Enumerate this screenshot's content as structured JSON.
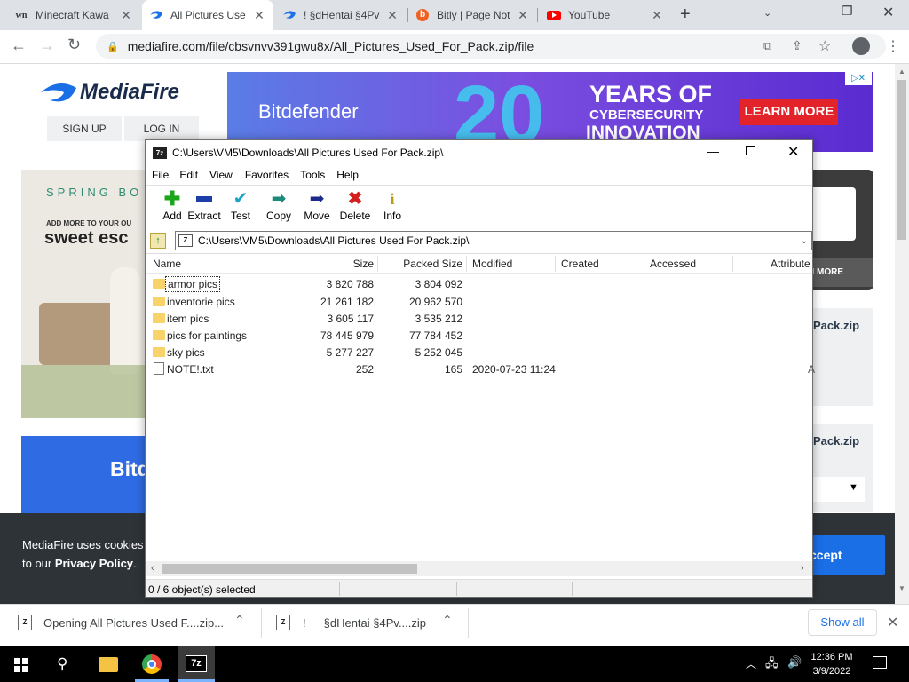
{
  "browser": {
    "tabs": [
      {
        "favicon": "wn",
        "title": "Minecraft Kawa",
        "active": false
      },
      {
        "favicon": "mediafire",
        "title": "All Pictures Use",
        "active": true
      },
      {
        "favicon": "mediafire",
        "title": "! §dHentai §4Pv",
        "active": false
      },
      {
        "favicon": "bitly",
        "title": "Bitly | Page Not",
        "active": false
      },
      {
        "favicon": "youtube",
        "title": "YouTube",
        "active": false
      }
    ],
    "url": "mediafire.com/file/cbsvnvv391gwu8x/All_Pictures_Used_For_Pack.zip/file"
  },
  "mediafire": {
    "logo": "MediaFire",
    "signup": "SIGN UP",
    "login": "LOG IN",
    "ad_banner": {
      "brand": "Bitdefender",
      "num": "20",
      "line1": "YEARS OF",
      "line2": "CYBERSECURITY",
      "line3": "INNOVATION",
      "cta": "LEARN MORE"
    },
    "side_ad": {
      "spring": "SPRING BO",
      "add_more": "ADD MORE TO YOUR OU",
      "sweet": "sweet esc"
    },
    "ad2_text": "Bitd",
    "learn_more_small": "N MORE",
    "file_label_1": "Pack.zip",
    "file_label_2": "Pack.zip",
    "cookie_line1": "MediaFire uses cookies",
    "cookie_line2a": "to our ",
    "cookie_link": "Privacy Policy",
    "cookie_line2b": "..",
    "accept": "ccept"
  },
  "zip": {
    "title": "C:\\Users\\VM5\\Downloads\\All Pictures Used For Pack.zip\\",
    "menu": [
      "File",
      "Edit",
      "View",
      "Favorites",
      "Tools",
      "Help"
    ],
    "toolbar": [
      {
        "id": "add",
        "label": "Add",
        "icon": "plus-icon",
        "color": "#1aa51a"
      },
      {
        "id": "extract",
        "label": "Extract",
        "icon": "minus-icon",
        "color": "#1b3fa8"
      },
      {
        "id": "test",
        "label": "Test",
        "icon": "check-icon",
        "color": "#19a3c7"
      },
      {
        "id": "copy",
        "label": "Copy",
        "icon": "copy-arrow-icon",
        "color": "#1a8a7a"
      },
      {
        "id": "move",
        "label": "Move",
        "icon": "move-arrow-icon",
        "color": "#1b2a8a"
      },
      {
        "id": "delete",
        "label": "Delete",
        "icon": "delete-x-icon",
        "color": "#d41f1f"
      },
      {
        "id": "info",
        "label": "Info",
        "icon": "info-icon",
        "color": "#b89a10"
      }
    ],
    "path": "C:\\Users\\VM5\\Downloads\\All Pictures Used For Pack.zip\\",
    "columns": {
      "name": "Name",
      "size": "Size",
      "packed": "Packed Size",
      "modified": "Modified",
      "created": "Created",
      "accessed": "Accessed",
      "attributes": "Attribute"
    },
    "files": [
      {
        "name": "armor pics",
        "type": "folder",
        "size": "3 820 788",
        "packed": "3 804 092",
        "modified": ""
      },
      {
        "name": "inventorie pics",
        "type": "folder",
        "size": "21 261 182",
        "packed": "20 962 570",
        "modified": ""
      },
      {
        "name": "item pics",
        "type": "folder",
        "size": "3 605 117",
        "packed": "3 535 212",
        "modified": ""
      },
      {
        "name": "pics for paintings",
        "type": "folder",
        "size": "78 445 979",
        "packed": "77 784 452",
        "modified": ""
      },
      {
        "name": "sky pics",
        "type": "folder",
        "size": "5 277 227",
        "packed": "5 252 045",
        "modified": ""
      },
      {
        "name": "NOTE!.txt",
        "type": "file",
        "size": "252",
        "packed": "165",
        "modified": "2020-07-23 11:24"
      }
    ],
    "attr_extra": "A",
    "status": "0 / 6 object(s) selected"
  },
  "downloads": {
    "item1": "Opening All Pictures Used F....zip...",
    "item2_prefix": "!",
    "item2": "§dHentai §4Pv....zip",
    "show_all": "Show all"
  },
  "taskbar": {
    "time": "12:36 PM",
    "date": "3/9/2022",
    "app_7z": "7z"
  }
}
